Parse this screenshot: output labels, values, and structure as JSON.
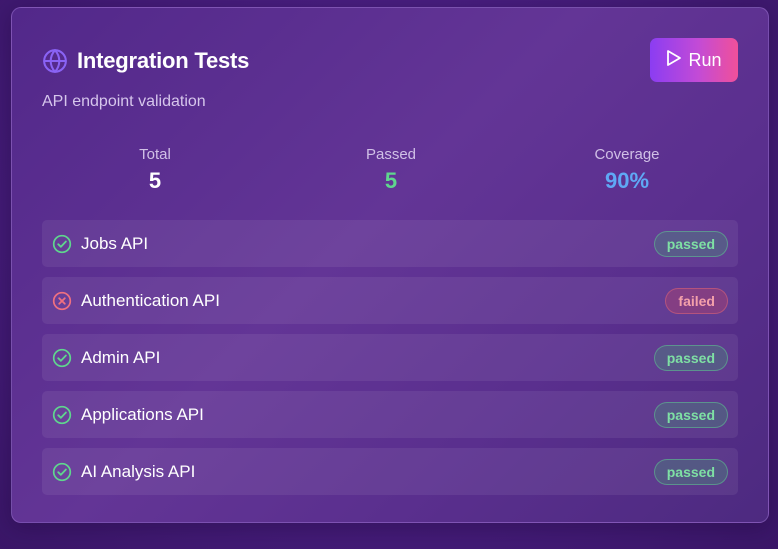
{
  "card": {
    "title": "Integration Tests",
    "subtitle": "API endpoint validation",
    "title_icon": "globe-icon",
    "run_button": {
      "label": "Run",
      "icon": "play-icon"
    }
  },
  "stats": [
    {
      "label": "Total",
      "value": "5",
      "color": "#ffffff"
    },
    {
      "label": "Passed",
      "value": "5",
      "color": "#5fd68e"
    },
    {
      "label": "Coverage",
      "value": "90%",
      "color": "#5fa8f5"
    }
  ],
  "tests": [
    {
      "name": "Jobs API",
      "status": "passed",
      "icon": "check-circle-icon"
    },
    {
      "name": "Authentication API",
      "status": "failed",
      "icon": "x-circle-icon"
    },
    {
      "name": "Admin API",
      "status": "passed",
      "icon": "check-circle-icon"
    },
    {
      "name": "Applications API",
      "status": "passed",
      "icon": "check-circle-icon"
    },
    {
      "name": "AI Analysis API",
      "status": "passed",
      "icon": "check-circle-icon"
    }
  ],
  "colors": {
    "passed": "#5fd68e",
    "failed": "#f07080",
    "accent_start": "#8b3df2",
    "accent_end": "#f0509a",
    "globe": "#8a63f5"
  }
}
